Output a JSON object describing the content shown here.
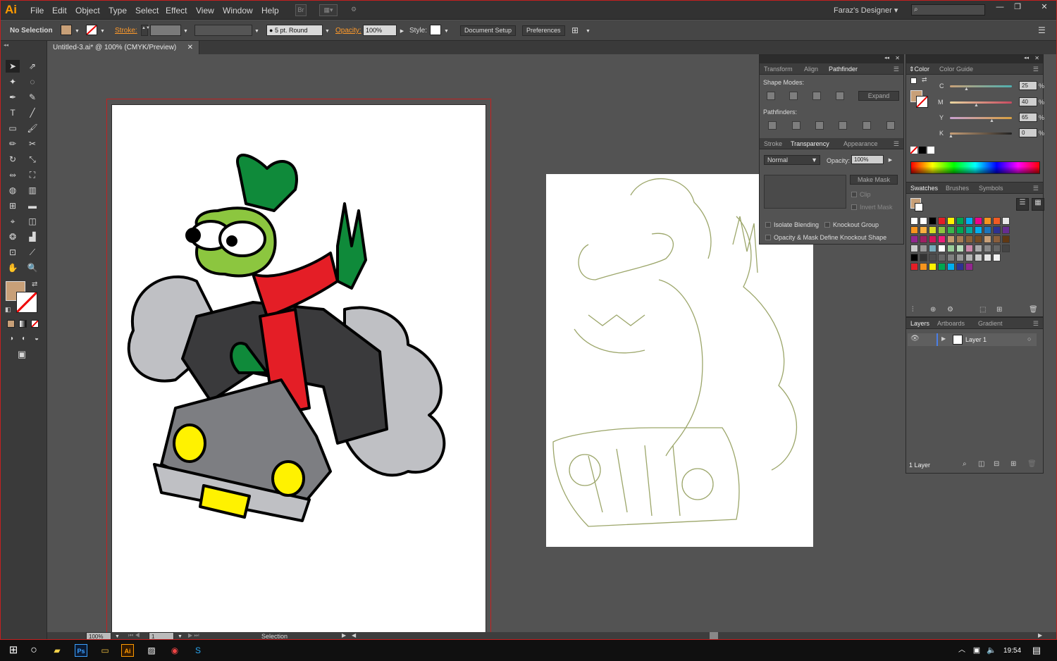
{
  "app": {
    "logo": "Ai",
    "doc_tab": "Untitled-3.ai* @ 100% (CMYK/Preview)",
    "workspace": "Faraz's Designer"
  },
  "menu": [
    "File",
    "Edit",
    "Object",
    "Type",
    "Select",
    "Effect",
    "View",
    "Window",
    "Help"
  ],
  "menu_buttons": {
    "bridge": "Br"
  },
  "control": {
    "selection": "No Selection",
    "stroke_label": "Stroke:",
    "brush": "5 pt. Round",
    "opacity_label": "Opacity:",
    "opacity": "100%",
    "style_label": "Style:",
    "document_setup": "Document Setup",
    "preferences": "Preferences"
  },
  "pathfinder": {
    "tabs": [
      "Transform",
      "Align",
      "Pathfinder"
    ],
    "shape_modes": "Shape Modes:",
    "expand": "Expand",
    "pathfinders": "Pathfinders:"
  },
  "transparency": {
    "tabs": [
      "Stroke",
      "Transparency",
      "Appearance"
    ],
    "mode": "Normal",
    "opacity_label": "Opacity:",
    "opacity": "100%",
    "make_mask": "Make Mask",
    "clip": "Clip",
    "invert_mask": "Invert Mask",
    "isolate": "Isolate Blending",
    "knockout": "Knockout Group",
    "opacity_mask": "Opacity & Mask Define Knockout Shape"
  },
  "color": {
    "tabs": [
      "Color",
      "Color Guide"
    ],
    "labels": [
      "C",
      "M",
      "Y",
      "K"
    ],
    "values": [
      "25",
      "40",
      "65",
      "0"
    ],
    "fill": "#c8a078",
    "pct": "%"
  },
  "swatches": {
    "tabs": [
      "Swatches",
      "Brushes",
      "Symbols"
    ]
  },
  "layers": {
    "tabs": [
      "Layers",
      "Artboards",
      "Gradient"
    ],
    "layer_name": "Layer 1",
    "count": "1 Layer"
  },
  "status": {
    "zoom": "100%",
    "artboard": "1",
    "tool": "Selection"
  },
  "taskbar": {
    "time": "19:54",
    "ps": "Ps",
    "ai": "Ai"
  }
}
